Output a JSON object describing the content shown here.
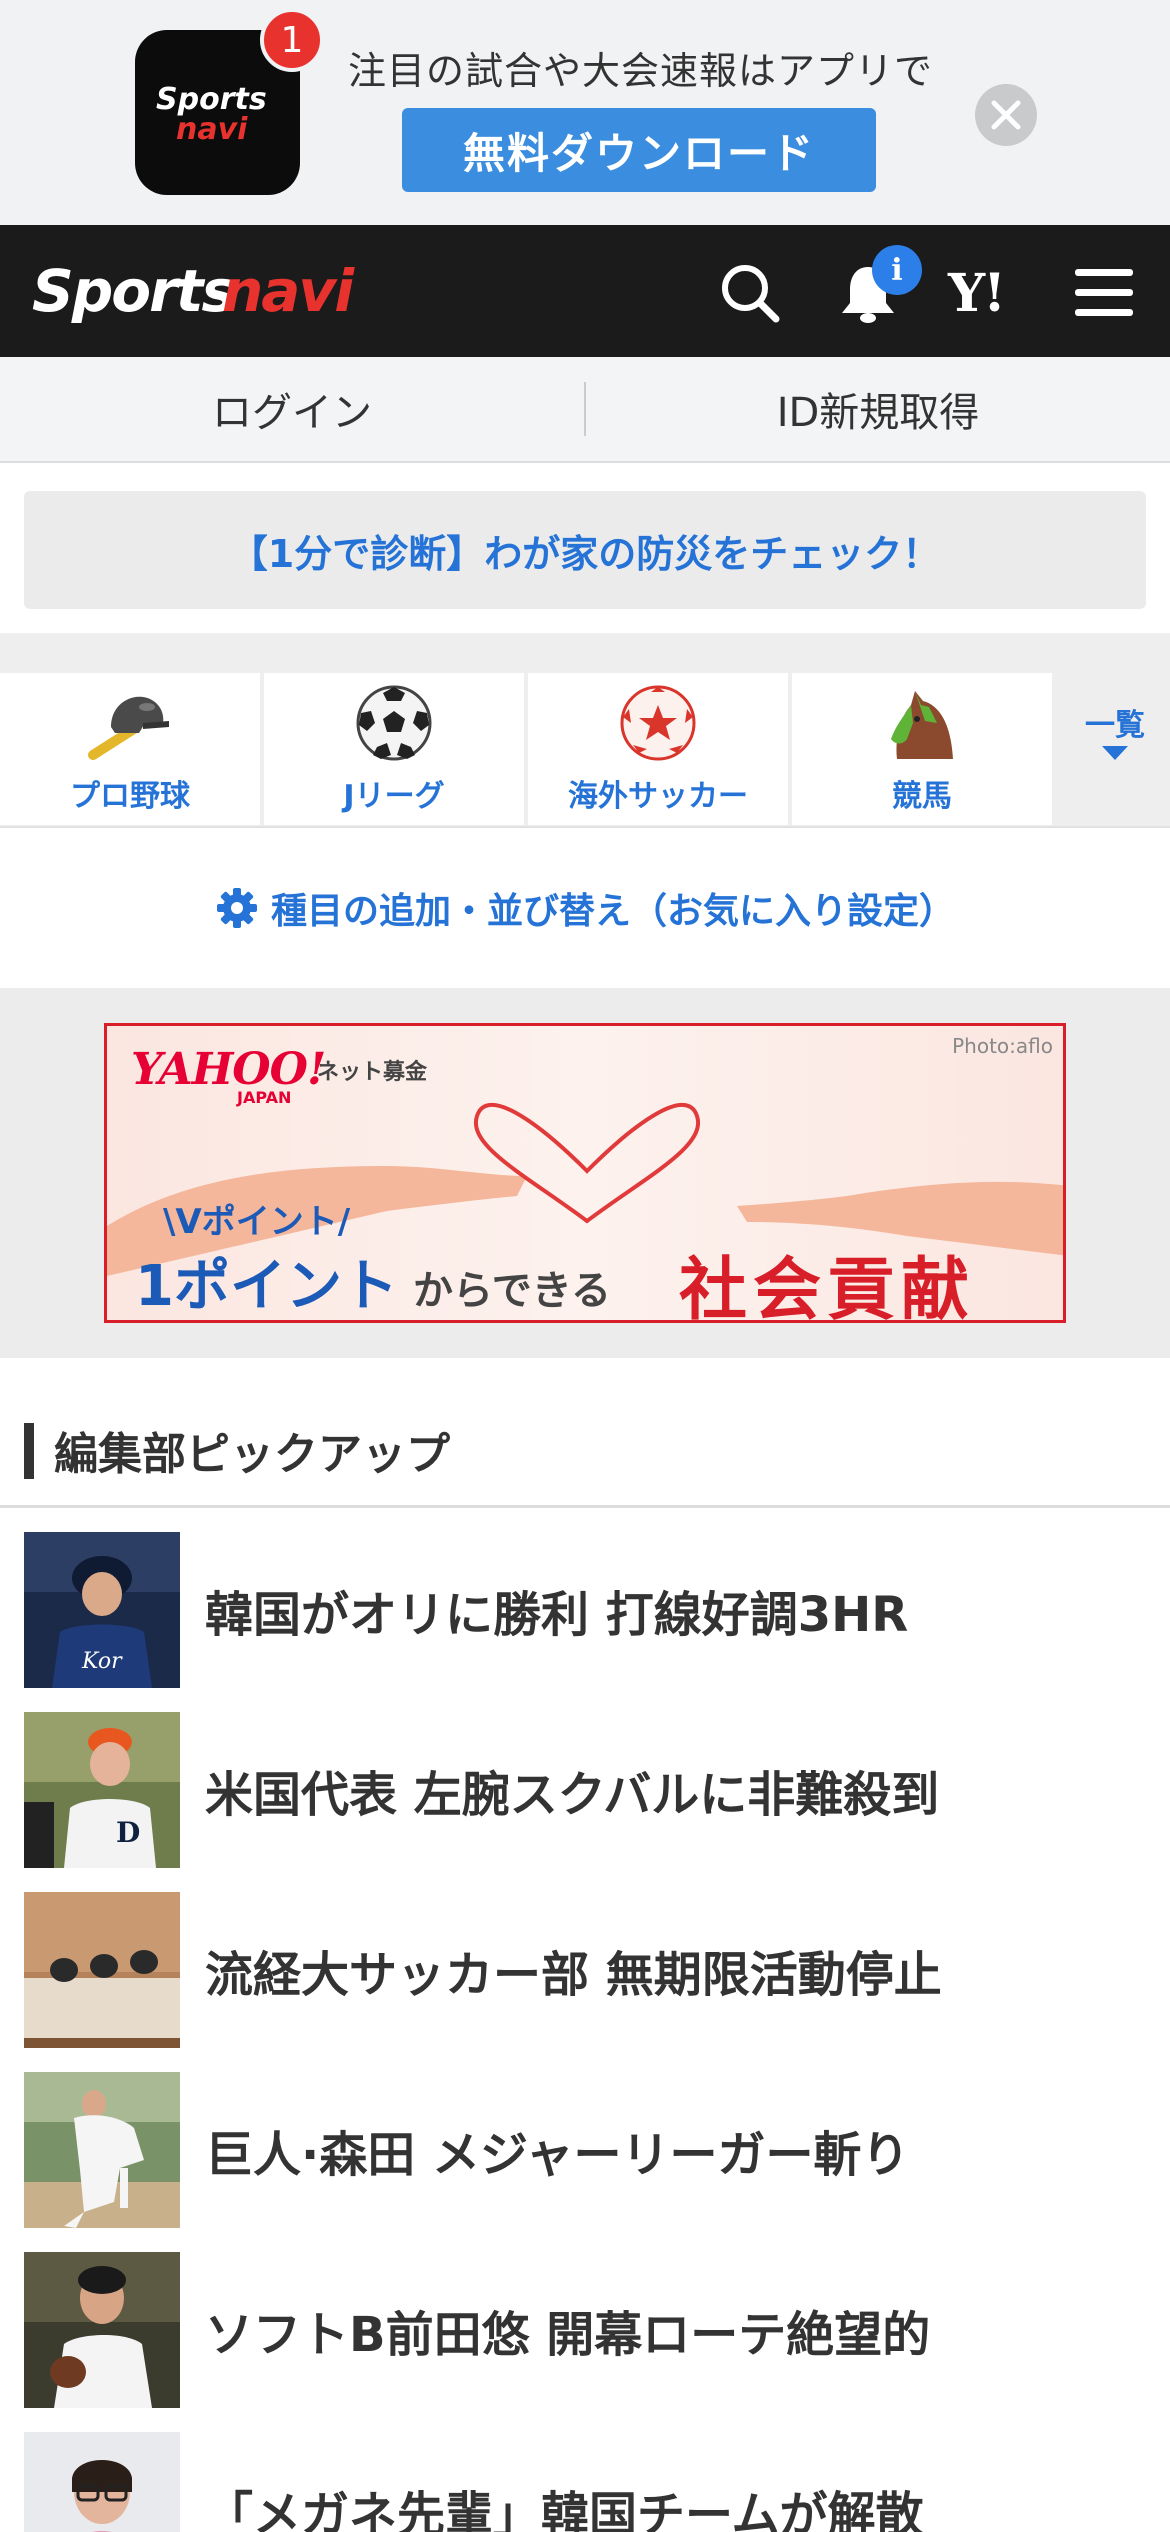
{
  "app_banner": {
    "badge_count": "1",
    "promo_text": "注目の試合や大会速報はアプリで",
    "download_label": "無料ダウンロード"
  },
  "header": {
    "notification_badge": "i",
    "yahoo_label": "Y!"
  },
  "auth": {
    "login_label": "ログイン",
    "register_label": "ID新規取得"
  },
  "promo": {
    "text": "【1分で診断】わが家の防災をチェック！"
  },
  "sports_nav": {
    "items": [
      {
        "label": "プロ野球",
        "icon": "baseball-helmet-icon"
      },
      {
        "label": "Jリーグ",
        "icon": "soccer-ball-icon"
      },
      {
        "label": "海外サッカー",
        "icon": "star-soccer-ball-icon"
      },
      {
        "label": "競馬",
        "icon": "horse-head-icon"
      }
    ],
    "more_label": "一覧",
    "settings_label": "種目の追加・並び替え（お気に入り設定）"
  },
  "ad": {
    "brand": "YAHOO!",
    "brand_sub": "JAPAN",
    "service": "ネット募金",
    "photo_credit": "Photo:aflo",
    "tagline_small": "\\Vポイント/",
    "tagline_big": "1ポイント",
    "tagline_mid": "からできる",
    "tagline_red": "社会貢献"
  },
  "pickup": {
    "title": "編集部ピックアップ",
    "articles": [
      {
        "title": "韓国がオリに勝利 打線好調3HR"
      },
      {
        "title": "米国代表 左腕スクバルに非難殺到"
      },
      {
        "title": "流経大サッカー部 無期限活動停止"
      },
      {
        "title": "巨人·森田 メジャーリーガー斬り"
      },
      {
        "title": "ソフトB前田悠 開幕ローテ絶望的"
      },
      {
        "title": "「メガネ先輩」韓国チームが解散"
      }
    ]
  },
  "colors": {
    "accent_blue": "#2573d6",
    "header_black": "#1b1b1b",
    "download_blue": "#3b8ddf",
    "badge_red": "#e8322e"
  }
}
